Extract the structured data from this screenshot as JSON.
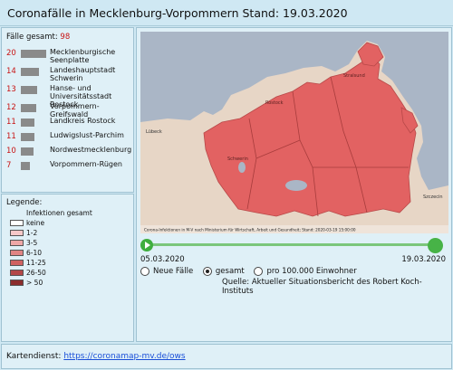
{
  "title": "Coronafälle in Mecklenburg-Vorpommern Stand: 19.03.2020",
  "total_label": "Fälle gesamt:",
  "total_value": "98",
  "districts": [
    {
      "count": 20,
      "label": "Mecklenburgische Seenplatte"
    },
    {
      "count": 14,
      "label": "Landeshauptstadt Schwerin"
    },
    {
      "count": 13,
      "label": "Hanse- und Universitätsstadt Rostock"
    },
    {
      "count": 12,
      "label": "Vorpommern-Greifswald"
    },
    {
      "count": 11,
      "label": "Landkreis Rostock"
    },
    {
      "count": 11,
      "label": "Ludwigslust-Parchim"
    },
    {
      "count": 10,
      "label": "Nordwestmecklenburg"
    },
    {
      "count": 7,
      "label": "Vorpommern-Rügen"
    }
  ],
  "legend": {
    "title": "Legende:",
    "subtitle": "Infektionen gesamt",
    "items": [
      {
        "label": "keine",
        "color": "#ffffff"
      },
      {
        "label": "1-2",
        "color": "#f6c8c8"
      },
      {
        "label": "3-5",
        "color": "#eea7a7"
      },
      {
        "label": "6-10",
        "color": "#e08484"
      },
      {
        "label": "11-25",
        "color": "#cf6161"
      },
      {
        "label": "26-50",
        "color": "#b34848"
      },
      {
        "label": "> 50",
        "color": "#8b2d2d"
      }
    ]
  },
  "map": {
    "caption": "Corona-Infektionen in M-V nach Ministerium für Wirtschaft, Arbeit und Gesundheit; Stand: 2020-03-19 15:00:00",
    "city_labels": [
      "Rostock",
      "Lübeck",
      "Schwerin",
      "Stralsund",
      "Szczecin"
    ],
    "sea_color": "#aab6c6",
    "fill_color": "#e26262"
  },
  "timeline": {
    "start_date": "05.03.2020",
    "end_date": "19.03.2020",
    "progress": 1.0
  },
  "radio_options": [
    {
      "label": "Neue Fälle",
      "selected": false
    },
    {
      "label": "gesamt",
      "selected": true
    },
    {
      "label": "pro 100.000 Einwohner",
      "selected": false
    }
  ],
  "source_text": "Quelle: Aktueller Situationsbericht des Robert Koch-Instituts",
  "footer": {
    "label": "Kartendienst:",
    "link": "https://coronamap-mv.de/ows"
  },
  "colors": {
    "accent_red": "#c81414",
    "bar_grey": "#8a8a8a",
    "panel_bg": "#dff0f7",
    "play_green": "#3fae3f"
  }
}
